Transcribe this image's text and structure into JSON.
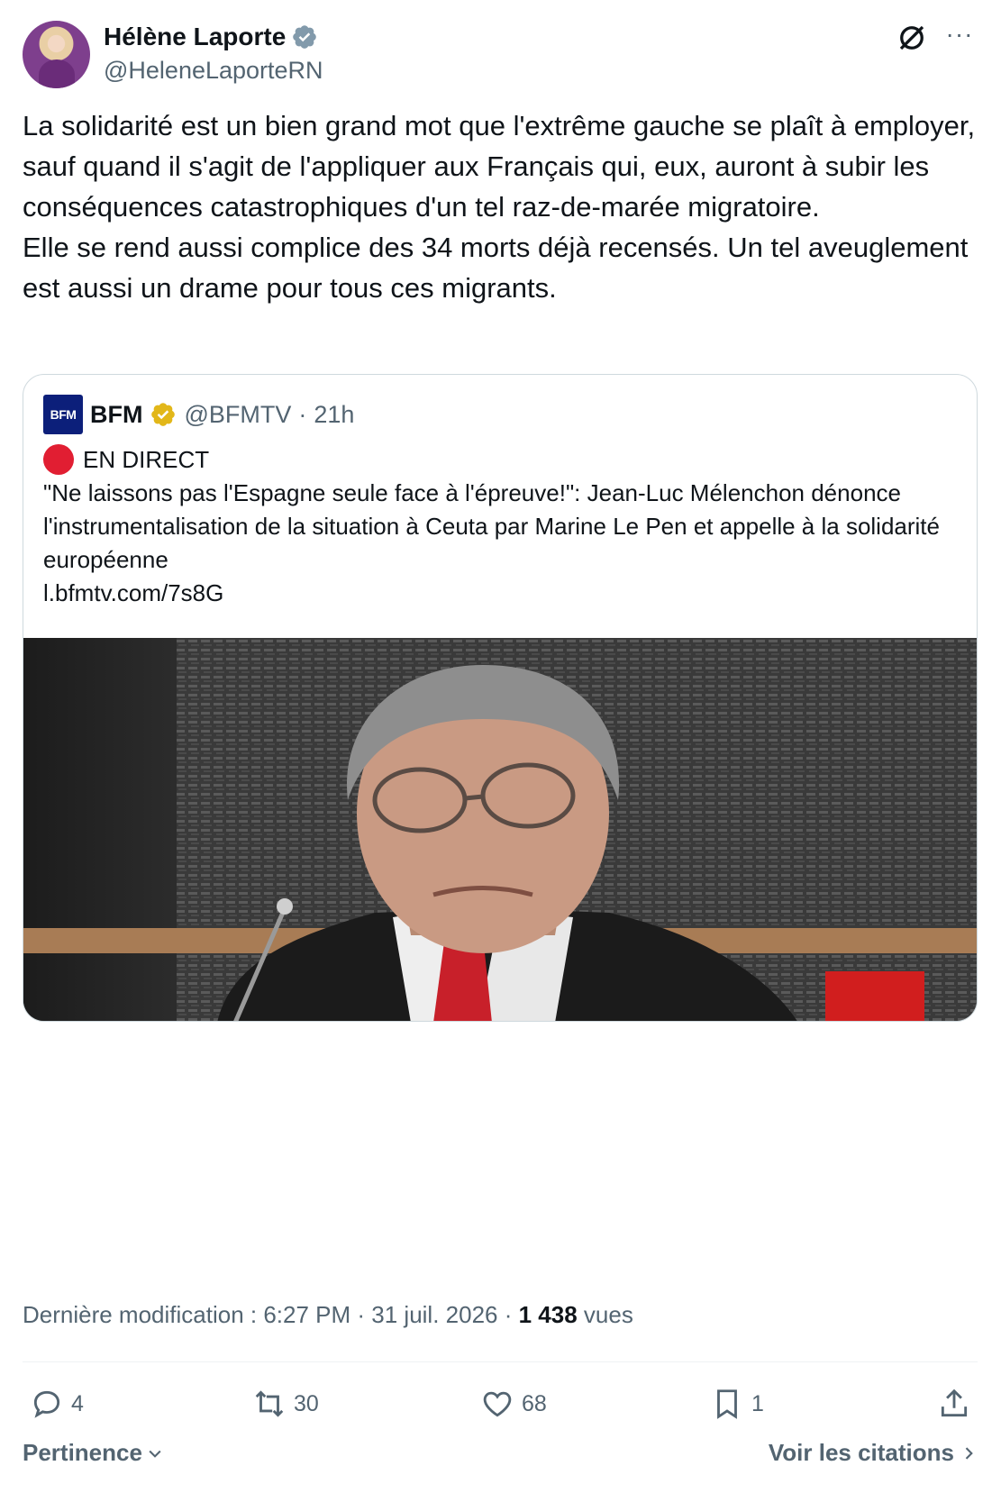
{
  "author": {
    "name": "Hélène Laporte",
    "handle": "@HeleneLaporteRN",
    "verified_badge_color": "#829aab"
  },
  "tweet": {
    "text": "La solidarité est un bien grand mot que l'extrême gauche se plaît à employer, sauf quand il s'agit de l'appliquer aux Français qui, eux, auront à subir les conséquences catastrophiques d'un tel raz-de-marée migratoire.\nElle se rend aussi complice des 34 morts déjà recensés. Un tel aveuglement est aussi un drame pour tous ces migrants."
  },
  "quote": {
    "logo_text": "BFM",
    "name": "BFM",
    "badge_color": "#e2b719",
    "handle": "@BFMTV",
    "separator": "·",
    "time": "21h",
    "live_label": "EN DIRECT",
    "headline": "\"Ne laissons pas l'Espagne seule face à l'épreuve!\": Jean-Luc Mélenchon dénonce l'instrumentalisation de la situation à Ceuta par Marine Le Pen et appelle à la solidarité européenne",
    "link": "l.bfmtv.com/7s8G"
  },
  "meta": {
    "prefix": "Dernière modification : 6:27 PM · 31 juil. 2026 · ",
    "views_count": "1 438",
    "views_label": " vues"
  },
  "actions": {
    "replies": "4",
    "reposts": "30",
    "likes": "68",
    "bookmarks": "1"
  },
  "footer": {
    "sort_label": "Pertinence",
    "citations_label": "Voir les citations"
  },
  "icons": [
    "grok-icon",
    "more-icon",
    "verified-badge-icon",
    "reply-icon",
    "repost-icon",
    "like-icon",
    "bookmark-icon",
    "share-icon",
    "chevron-down-icon",
    "chevron-right-icon"
  ]
}
